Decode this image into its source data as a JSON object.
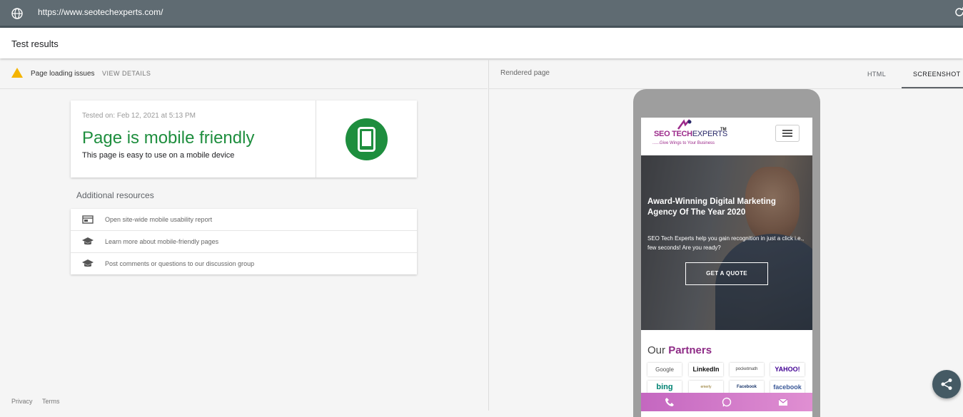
{
  "browser": {
    "url": "https://www.seotechexperts.com/"
  },
  "header": {
    "title": "Test results"
  },
  "issues": {
    "label": "Page loading issues",
    "view_details": "VIEW DETAILS"
  },
  "result": {
    "tested_on": "Tested on: Feb 12, 2021 at 5:13 PM",
    "title": "Page is mobile friendly",
    "subtitle": "This page is easy to use on a mobile device",
    "status_color": "#1e8e3e"
  },
  "resources": {
    "title": "Additional resources",
    "items": [
      {
        "label": "Open site-wide mobile usability report",
        "icon": "report-icon"
      },
      {
        "label": "Learn more about mobile-friendly pages",
        "icon": "school-icon"
      },
      {
        "label": "Post comments or questions to our discussion group",
        "icon": "school-icon"
      }
    ]
  },
  "footer": {
    "privacy": "Privacy",
    "terms": "Terms"
  },
  "rendered": {
    "label": "Rendered page",
    "tabs": [
      {
        "label": "HTML",
        "active": false
      },
      {
        "label": "SCREENSHOT",
        "active": true
      }
    ]
  },
  "site": {
    "logo_main": "SEO TECH",
    "logo_alt": "EXPERTS",
    "logo_tm": "TM",
    "logo_tagline": "......Give Wings to Your Business",
    "hero_title": "Award-Winning Digital Marketing Agency Of The Year 2020",
    "hero_text": "SEO Tech Experts help you gain recognition in just a click i.e., few seconds! Are you ready?",
    "cta": "GET A QUOTE",
    "partners_title_a": "Our",
    "partners_title_b": "Partners",
    "partners": [
      "Google Partner",
      "LinkedIn",
      "pocketmath",
      "YAHOO!",
      "bing",
      "emerly",
      "Facebook Exchange",
      "facebook"
    ],
    "accent": "#8e2b86"
  }
}
